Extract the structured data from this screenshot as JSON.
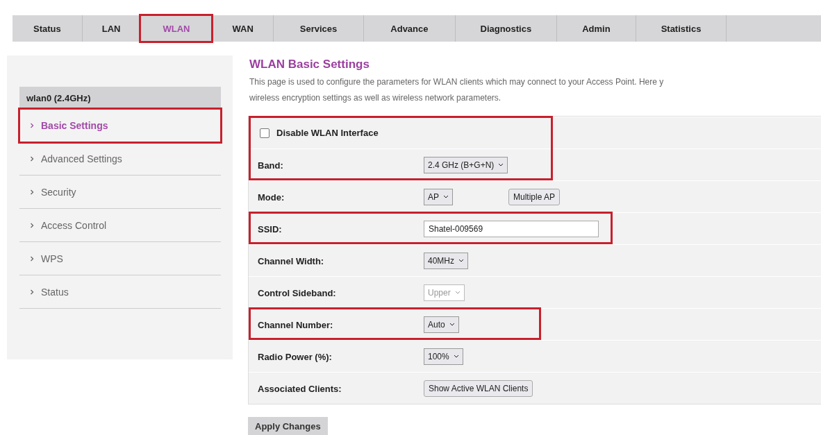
{
  "tabs": [
    {
      "label": "Status",
      "selected": false,
      "highlighted": false
    },
    {
      "label": "LAN",
      "selected": false,
      "highlighted": false
    },
    {
      "label": "WLAN",
      "selected": true,
      "highlighted": true
    },
    {
      "label": "WAN",
      "selected": false,
      "highlighted": false
    },
    {
      "label": "Services",
      "selected": false,
      "highlighted": false
    },
    {
      "label": "Advance",
      "selected": false,
      "highlighted": false
    },
    {
      "label": "Diagnostics",
      "selected": false,
      "highlighted": false
    },
    {
      "label": "Admin",
      "selected": false,
      "highlighted": false
    },
    {
      "label": "Statistics",
      "selected": false,
      "highlighted": false
    }
  ],
  "sidebar": {
    "header": "wlan0 (2.4GHz)",
    "items": [
      {
        "label": "Basic Settings",
        "selected": true,
        "highlighted": true
      },
      {
        "label": "Advanced Settings",
        "selected": false,
        "highlighted": false
      },
      {
        "label": "Security",
        "selected": false,
        "highlighted": false
      },
      {
        "label": "Access Control",
        "selected": false,
        "highlighted": false
      },
      {
        "label": "WPS",
        "selected": false,
        "highlighted": false
      },
      {
        "label": "Status",
        "selected": false,
        "highlighted": false
      }
    ]
  },
  "title": "WLAN Basic Settings",
  "description": [
    "This page is used to configure the parameters for WLAN clients which may connect to your Access Point. Here y",
    "wireless encryption settings as well as wireless network parameters."
  ],
  "form": {
    "groups": [
      {
        "highlighted": true,
        "rows": [
          {
            "kind": "checkbox",
            "label": "Disable WLAN Interface",
            "checked": false
          },
          {
            "kind": "select",
            "label": "Band:",
            "value": "2.4 GHz (B+G+N)",
            "disabled": false
          }
        ]
      },
      {
        "highlighted": false,
        "rows": [
          {
            "kind": "select",
            "label": "Mode:",
            "value": "AP",
            "disabled": false,
            "button": "Multiple AP"
          }
        ]
      },
      {
        "highlighted": true,
        "rows": [
          {
            "kind": "text",
            "label": "SSID:",
            "value": "Shatel-009569"
          }
        ]
      },
      {
        "highlighted": false,
        "rows": [
          {
            "kind": "select",
            "label": "Channel Width:",
            "value": "40MHz",
            "disabled": false
          },
          {
            "kind": "select",
            "label": "Control Sideband:",
            "value": "Upper",
            "disabled": true
          }
        ]
      },
      {
        "highlighted": true,
        "rows": [
          {
            "kind": "select",
            "label": "Channel Number:",
            "value": "Auto",
            "disabled": false
          }
        ]
      },
      {
        "highlighted": false,
        "rows": [
          {
            "kind": "select",
            "label": "Radio Power (%):",
            "value": "100%",
            "disabled": false
          },
          {
            "kind": "button",
            "label": "Associated Clients:",
            "button": "Show Active WLAN Clients"
          }
        ]
      }
    ]
  },
  "apply_button": "Apply Changes"
}
